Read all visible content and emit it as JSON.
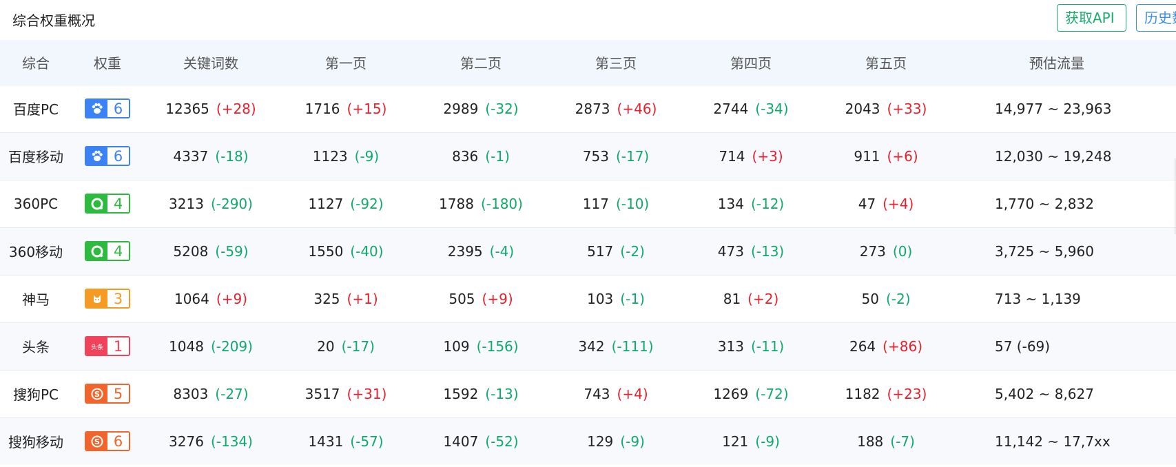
{
  "title": "综合权重概况",
  "buttons": {
    "api": "获取API",
    "history": "历史数据"
  },
  "columns": [
    "综合",
    "权重",
    "关键词数",
    "第一页",
    "第二页",
    "第三页",
    "第四页",
    "第五页",
    "预估流量"
  ],
  "colors": {
    "positive": "#e8202c",
    "negative": "#0fa96b"
  },
  "rows": [
    {
      "engine": "百度PC",
      "icon": "baidu-icon",
      "color": "#3b82f6",
      "weight": "6",
      "cells": [
        [
          "12365",
          "+28"
        ],
        [
          "1716",
          "+15"
        ],
        [
          "2989",
          "-32"
        ],
        [
          "2873",
          "+46"
        ],
        [
          "2744",
          "-34"
        ],
        [
          "2043",
          "+33"
        ]
      ],
      "traffic": "14,977 ~ 23,963"
    },
    {
      "engine": "百度移动",
      "icon": "baidu-icon",
      "color": "#3b82f6",
      "weight": "6",
      "cells": [
        [
          "4337",
          "-18"
        ],
        [
          "1123",
          "-9"
        ],
        [
          "836",
          "-1"
        ],
        [
          "753",
          "-17"
        ],
        [
          "714",
          "+3"
        ],
        [
          "911",
          "+6"
        ]
      ],
      "traffic": "12,030 ~ 19,248"
    },
    {
      "engine": "360PC",
      "icon": "360-icon",
      "color": "#2dbb3f",
      "weight": "4",
      "cells": [
        [
          "3213",
          "-290"
        ],
        [
          "1127",
          "-92"
        ],
        [
          "1788",
          "-180"
        ],
        [
          "117",
          "-10"
        ],
        [
          "134",
          "-12"
        ],
        [
          "47",
          "+4"
        ]
      ],
      "traffic": "1,770 ~ 2,832"
    },
    {
      "engine": "360移动",
      "icon": "360-icon",
      "color": "#2dbb3f",
      "weight": "4",
      "cells": [
        [
          "5208",
          "-59"
        ],
        [
          "1550",
          "-40"
        ],
        [
          "2395",
          "-4"
        ],
        [
          "517",
          "-2"
        ],
        [
          "473",
          "-13"
        ],
        [
          "273",
          "0"
        ]
      ],
      "traffic": "3,725 ~ 5,960"
    },
    {
      "engine": "神马",
      "icon": "shenma-icon",
      "color": "#f59a23",
      "weight": "3",
      "cells": [
        [
          "1064",
          "+9"
        ],
        [
          "325",
          "+1"
        ],
        [
          "505",
          "+9"
        ],
        [
          "103",
          "-1"
        ],
        [
          "81",
          "+2"
        ],
        [
          "50",
          "-2"
        ]
      ],
      "traffic": "713 ~ 1,139"
    },
    {
      "engine": "头条",
      "icon": "toutiao-icon",
      "color": "#f0435a",
      "weight": "1",
      "cells": [
        [
          "1048",
          "-209"
        ],
        [
          "20",
          "-17"
        ],
        [
          "109",
          "-156"
        ],
        [
          "342",
          "-111"
        ],
        [
          "313",
          "-11"
        ],
        [
          "264",
          "+86"
        ]
      ],
      "traffic": "57 (-69)"
    },
    {
      "engine": "搜狗PC",
      "icon": "sogou-icon",
      "color": "#f2642b",
      "weight": "5",
      "cells": [
        [
          "8303",
          "-27"
        ],
        [
          "3517",
          "+31"
        ],
        [
          "1592",
          "-13"
        ],
        [
          "743",
          "+4"
        ],
        [
          "1269",
          "-72"
        ],
        [
          "1182",
          "+23"
        ]
      ],
      "traffic": "5,402 ~ 8,627"
    },
    {
      "engine": "搜狗移动",
      "icon": "sogou-icon",
      "color": "#f2642b",
      "weight": "6",
      "cells": [
        [
          "3276",
          "-134"
        ],
        [
          "1431",
          "-57"
        ],
        [
          "1407",
          "-52"
        ],
        [
          "129",
          "-9"
        ],
        [
          "121",
          "-9"
        ],
        [
          "188",
          "-7"
        ]
      ],
      "traffic": "11,142 ~ 17,7xx"
    }
  ]
}
